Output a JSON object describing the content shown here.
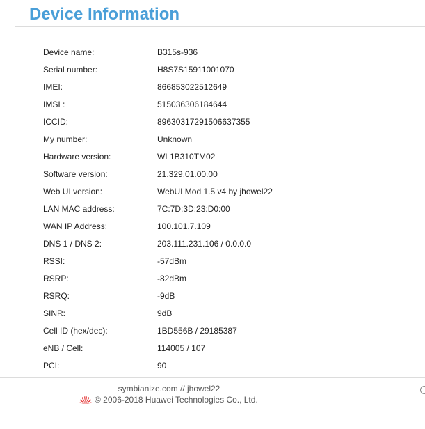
{
  "header": {
    "title": "Device Information"
  },
  "device_info": {
    "rows": [
      {
        "label": "Device name:",
        "value": "B315s-936"
      },
      {
        "label": "Serial number:",
        "value": "H8S7S15911001070"
      },
      {
        "label": "IMEI:",
        "value": "866853022512649"
      },
      {
        "label": "IMSI :",
        "value": "515036306184644"
      },
      {
        "label": "ICCID:",
        "value": "89630317291506637355"
      },
      {
        "label": "My number:",
        "value": "Unknown"
      },
      {
        "label": "Hardware version:",
        "value": "WL1B310TM02"
      },
      {
        "label": "Software version:",
        "value": "21.329.01.00.00"
      },
      {
        "label": "Web UI version:",
        "value": "WebUI Mod 1.5 v4 by jhowel22"
      },
      {
        "label": "LAN MAC address:",
        "value": "7C:7D:3D:23:D0:00"
      },
      {
        "label": "WAN IP Address:",
        "value": "100.101.7.109"
      },
      {
        "label": "DNS 1 / DNS 2:",
        "value": "203.111.231.106 / 0.0.0.0"
      },
      {
        "label": "RSSI:",
        "value": "-57dBm"
      },
      {
        "label": "RSRP:",
        "value": "-82dBm"
      },
      {
        "label": "RSRQ:",
        "value": "-9dB"
      },
      {
        "label": "SINR:",
        "value": "9dB"
      },
      {
        "label": "Cell ID (hex/dec):",
        "value": "1BD556B / 29185387"
      },
      {
        "label": "eNB / Cell:",
        "value": "114005 / 107"
      },
      {
        "label": "PCI:",
        "value": "90"
      }
    ]
  },
  "footer": {
    "credit": "symbianize.com // jhowel22",
    "copyright": "© 2006-2018 Huawei Technologies Co., Ltd.",
    "logo_icon": "huawei-logo-icon",
    "brand_color": "#e02020"
  },
  "colors": {
    "title": "#4a9fd8"
  }
}
